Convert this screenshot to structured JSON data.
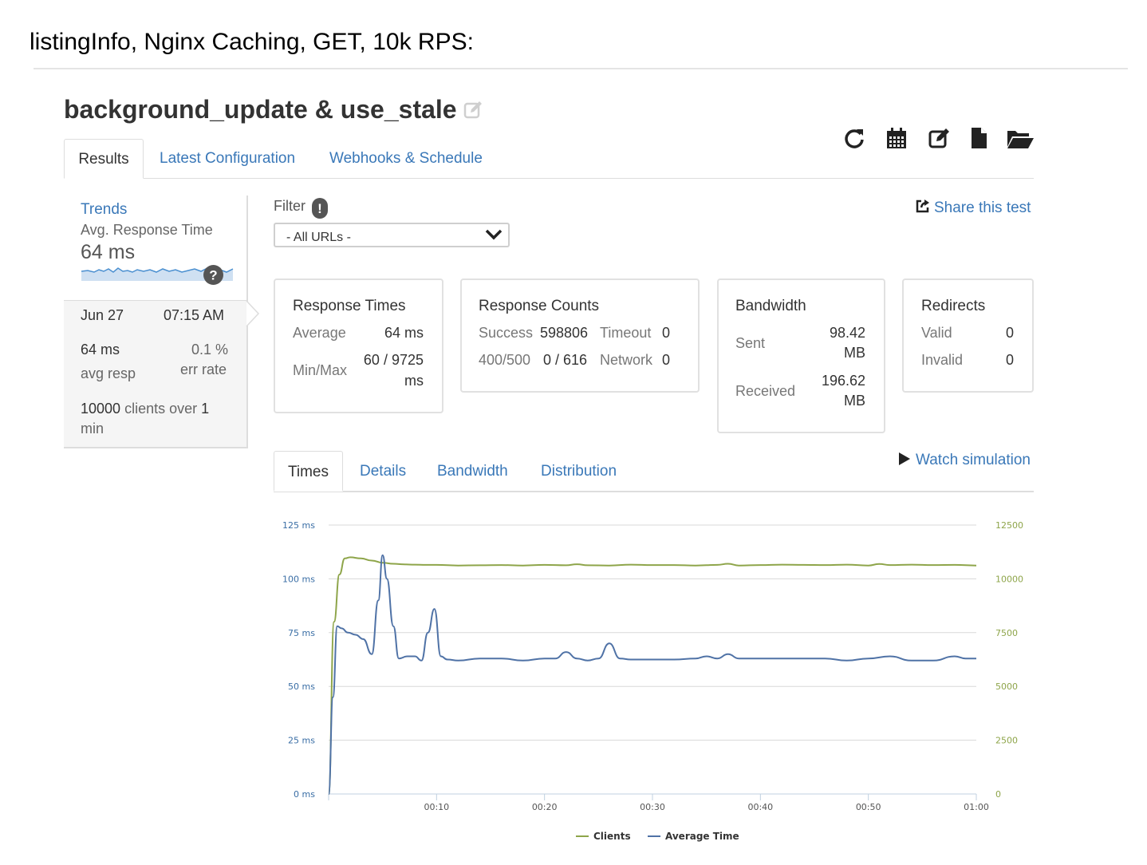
{
  "caption": "listingInfo, Nginx Caching, GET, 10k RPS:",
  "test": {
    "title": "background_update & use_stale"
  },
  "toolbar": {
    "icons": [
      "refresh-icon",
      "calendar-icon",
      "edit-icon",
      "file-icon",
      "folder-open-icon"
    ]
  },
  "tabs": {
    "results": "Results",
    "latest_config": "Latest Configuration",
    "webhooks": "Webhooks & Schedule"
  },
  "trends": {
    "link": "Trends",
    "metric": "Avg. Response Time",
    "value": "64 ms",
    "help": "?"
  },
  "run": {
    "date": "Jun 27",
    "time": "07:15 AM",
    "avg_value": "64 ms",
    "avg_label": "avg resp",
    "err_value": "0.1 %",
    "err_label": "err rate",
    "clients_count": "10000",
    "clients_text_1": "clients over",
    "clients_num": "1",
    "clients_text_2": "min"
  },
  "filter": {
    "label": "Filter",
    "help": "!",
    "selected": "- All URLs -"
  },
  "share": {
    "label": "Share this test"
  },
  "cards": {
    "response_times": {
      "title": "Response Times",
      "average_label": "Average",
      "average_value": "64 ms",
      "minmax_label": "Min/Max",
      "minmax_value_1": "60 / 9725",
      "minmax_value_2": "ms"
    },
    "response_counts": {
      "title": "Response Counts",
      "success_label": "Success",
      "success_value": "598806",
      "timeout_label": "Timeout",
      "timeout_value": "0",
      "error_label": "400/500",
      "error_value": "0 / 616",
      "network_label": "Network",
      "network_value": "0"
    },
    "bandwidth": {
      "title": "Bandwidth",
      "sent_label": "Sent",
      "sent_value_1": "98.42",
      "sent_value_2": "MB",
      "received_label": "Received",
      "received_value_1": "196.62",
      "received_value_2": "MB"
    },
    "redirects": {
      "title": "Redirects",
      "valid_label": "Valid",
      "valid_value": "0",
      "invalid_label": "Invalid",
      "invalid_value": "0"
    }
  },
  "chart_tabs": {
    "times": "Times",
    "details": "Details",
    "bandwidth": "Bandwidth",
    "distribution": "Distribution"
  },
  "watch": {
    "label": "Watch simulation"
  },
  "colors": {
    "clients": "#8ea54a",
    "average_time": "#4f72a6",
    "link": "#3a78b8"
  },
  "chart_data": {
    "type": "line",
    "x_ticks": [
      "00:10",
      "00:20",
      "00:30",
      "00:40",
      "00:50",
      "01:00"
    ],
    "y_left_ticks": [
      "0 ms",
      "25 ms",
      "50 ms",
      "75 ms",
      "100 ms",
      "125 ms"
    ],
    "y_right_ticks": [
      "0",
      "2500",
      "5000",
      "7500",
      "10000",
      "12500"
    ],
    "y_left_range": [
      0,
      125
    ],
    "y_right_range": [
      0,
      12500
    ],
    "x_range": [
      0,
      60
    ],
    "legend_position": "bottom",
    "grid": true,
    "series": [
      {
        "name": "Clients",
        "axis": "right",
        "x": [
          0,
          0.5,
          1,
          1.5,
          2,
          3,
          4,
          5,
          6,
          7,
          8,
          9,
          10,
          12,
          14,
          16,
          18,
          20,
          22,
          23,
          24,
          26,
          28,
          30,
          32,
          34,
          36,
          37,
          38,
          40,
          42,
          44,
          46,
          48,
          50,
          51,
          52,
          54,
          56,
          58,
          60
        ],
        "y": [
          0,
          8000,
          10200,
          10950,
          11000,
          10950,
          10850,
          10750,
          10700,
          10670,
          10660,
          10650,
          10650,
          10620,
          10630,
          10640,
          10620,
          10650,
          10630,
          10680,
          10630,
          10620,
          10660,
          10640,
          10640,
          10620,
          10650,
          10700,
          10620,
          10640,
          10660,
          10650,
          10640,
          10660,
          10620,
          10690,
          10640,
          10660,
          10640,
          10650,
          10620
        ]
      },
      {
        "name": "Average Time",
        "axis": "left",
        "x": [
          0,
          0.4,
          0.8,
          1.2,
          1.8,
          2.5,
          3.2,
          4,
          4.6,
          5,
          5.4,
          6,
          6.5,
          7.3,
          8,
          8.6,
          9.2,
          9.8,
          10.4,
          11,
          12,
          14,
          16,
          18,
          20,
          21,
          22,
          23,
          24,
          25,
          26,
          27,
          28,
          30,
          32,
          34,
          35,
          36,
          37,
          38,
          40,
          42,
          44,
          46,
          48,
          50,
          52,
          54,
          55,
          56,
          58,
          59,
          60
        ],
        "y": [
          0,
          45,
          78,
          77,
          75,
          74,
          72,
          65,
          90,
          111,
          100,
          78,
          63,
          64,
          64,
          62,
          75,
          86,
          64,
          62.5,
          62,
          63,
          63,
          62,
          63,
          63,
          66,
          63,
          62,
          63,
          70,
          63,
          62.5,
          62.5,
          62.5,
          63,
          64,
          63,
          65,
          63,
          63,
          63,
          63,
          63,
          62,
          63,
          64,
          62,
          62,
          62,
          64,
          63,
          63
        ]
      }
    ]
  }
}
